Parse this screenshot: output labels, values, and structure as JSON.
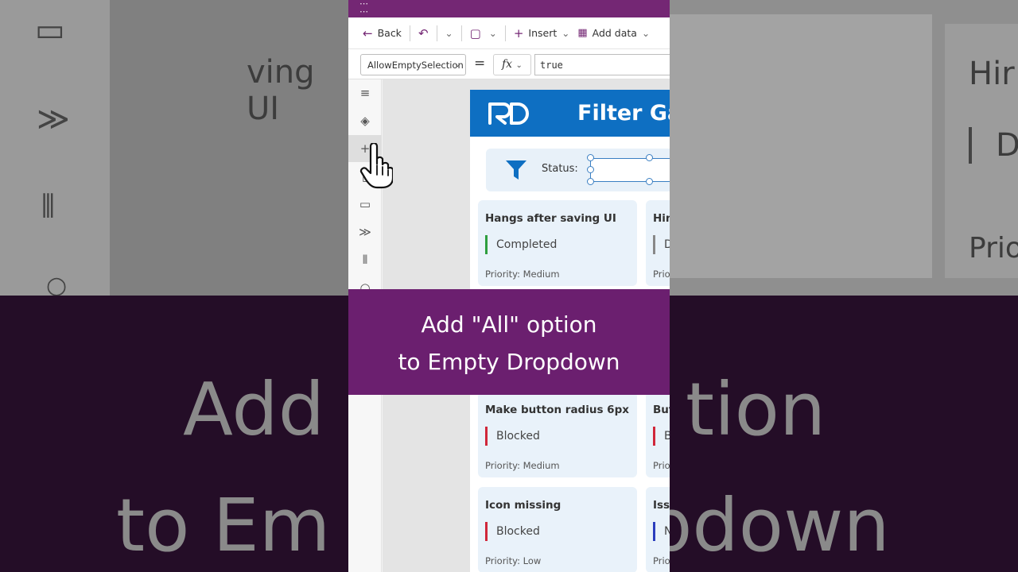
{
  "toolbar": {
    "back_label": "Back",
    "insert_label": "Insert",
    "add_data_label": "Add data"
  },
  "formula_bar": {
    "property": "AllowEmptySelection",
    "equals": "=",
    "fx": "fx",
    "formula": "true"
  },
  "app": {
    "title": "Filter Gal",
    "logo_text": "RD",
    "filter_label": "Status:",
    "cards": [
      {
        "title": "Hangs after saving UI",
        "status": "Completed",
        "priority": "Priority: Medium",
        "color": "#2e9e3e"
      },
      {
        "title": "Hin",
        "status": "D",
        "priority": "Prio",
        "color": "#888888"
      },
      {
        "title": "Make button radius 6px",
        "status": "Blocked",
        "priority": "Priority: Medium",
        "color": "#d0273a"
      },
      {
        "title": "But",
        "status": "B",
        "priority": "Prio",
        "color": "#d0273a"
      },
      {
        "title": "Icon missing",
        "status": "Blocked",
        "priority": "Priority: Low",
        "color": "#d0273a"
      },
      {
        "title": "Issu",
        "status": "N",
        "priority": "Prio",
        "color": "#2b3dbd"
      }
    ]
  },
  "caption": {
    "line1": "Add \"All\" option",
    "line2": "to Empty Dropdown"
  },
  "backdrop": {
    "left_text": "ving UI",
    "right_title": "Hir",
    "right_status": "D",
    "right_priority": "Prio",
    "left_big_1": "Add",
    "right_big_1": "tion",
    "left_big_2": "to Em",
    "right_big_2": "pdown"
  },
  "colors": {
    "brand_purple": "#742774",
    "header_blue": "#0e6fc2",
    "caption_bg": "#6b1f6f"
  }
}
